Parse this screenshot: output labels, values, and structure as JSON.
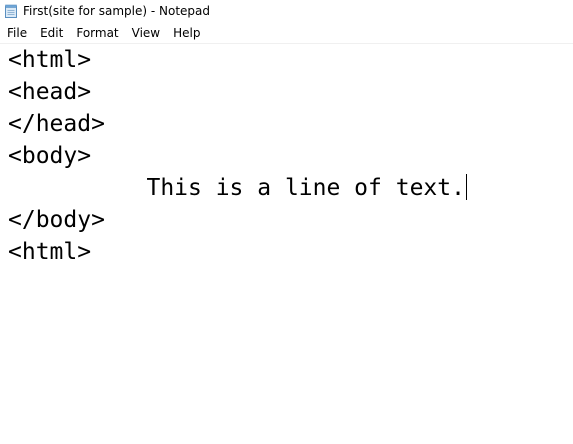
{
  "window": {
    "title": "First(site for sample) - Notepad",
    "icon": "notepad-icon"
  },
  "menu": {
    "items": [
      "File",
      "Edit",
      "Format",
      "View",
      "Help"
    ]
  },
  "editor": {
    "lines": [
      "<html>",
      "<head>",
      "</head>",
      "<body>",
      "          This is a line of text.",
      "</body>",
      "<html>"
    ],
    "caret_line": 5
  }
}
